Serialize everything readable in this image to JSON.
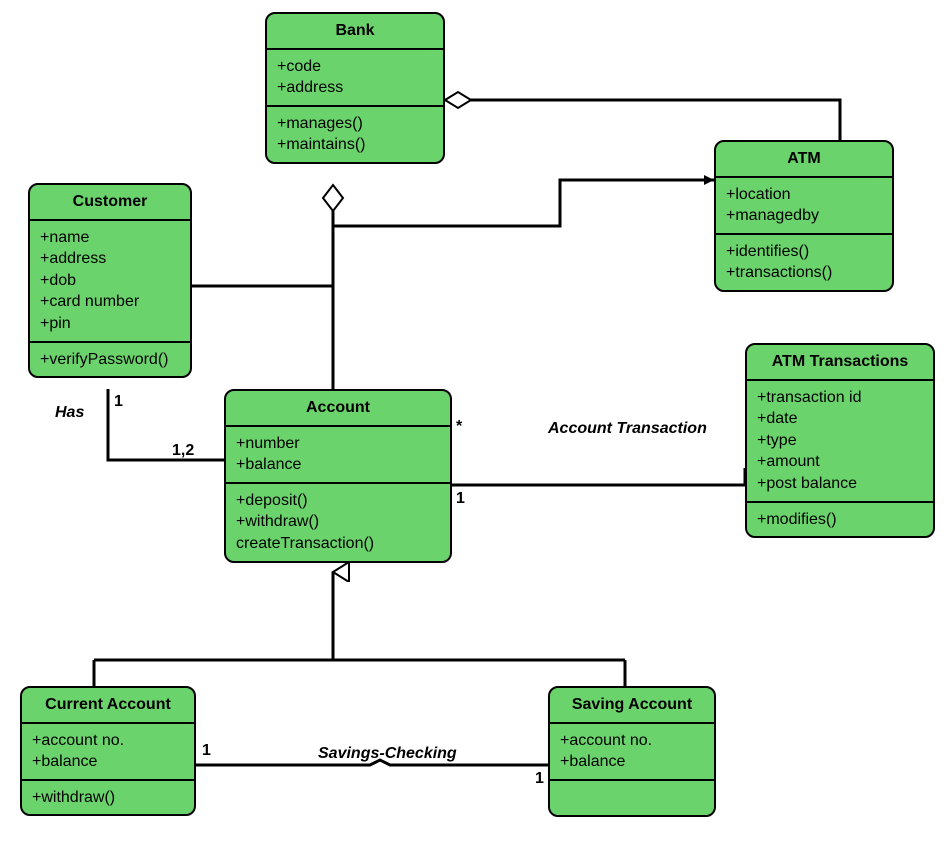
{
  "classes": {
    "bank": {
      "title": "Bank",
      "attributes": [
        "+code",
        "+address"
      ],
      "operations": [
        "+manages()",
        "+maintains()"
      ]
    },
    "customer": {
      "title": "Customer",
      "attributes": [
        "+name",
        "+address",
        "+dob",
        "+card number",
        "+pin"
      ],
      "operations": [
        "+verifyPassword()"
      ]
    },
    "atm": {
      "title": "ATM",
      "attributes": [
        "+location",
        "+managedby"
      ],
      "operations": [
        "+identifies()",
        "+transactions()"
      ]
    },
    "account": {
      "title": "Account",
      "attributes": [
        "+number",
        "+balance"
      ],
      "operations": [
        "+deposit()",
        "+withdraw()",
        "createTransaction()"
      ]
    },
    "atm_transactions": {
      "title": "ATM Transactions",
      "attributes": [
        "+transaction id",
        "+date",
        "+type",
        "+amount",
        "+post balance"
      ],
      "operations": [
        "+modifies()"
      ]
    },
    "current_account": {
      "title": "Current Account",
      "attributes": [
        "+account no.",
        "+balance"
      ],
      "operations": [
        "+withdraw()"
      ]
    },
    "saving_account": {
      "title": "Saving Account",
      "attributes": [
        "+account no.",
        "+balance"
      ],
      "operations": []
    }
  },
  "labels": {
    "has": "Has",
    "account_transaction": "Account Transaction",
    "savings_checking": "Savings-Checking"
  },
  "multiplicities": {
    "customer_has_1": "1",
    "customer_has_12": "1,2",
    "account_star": "*",
    "account_1": "1",
    "current_1": "1",
    "saving_1": "1"
  }
}
